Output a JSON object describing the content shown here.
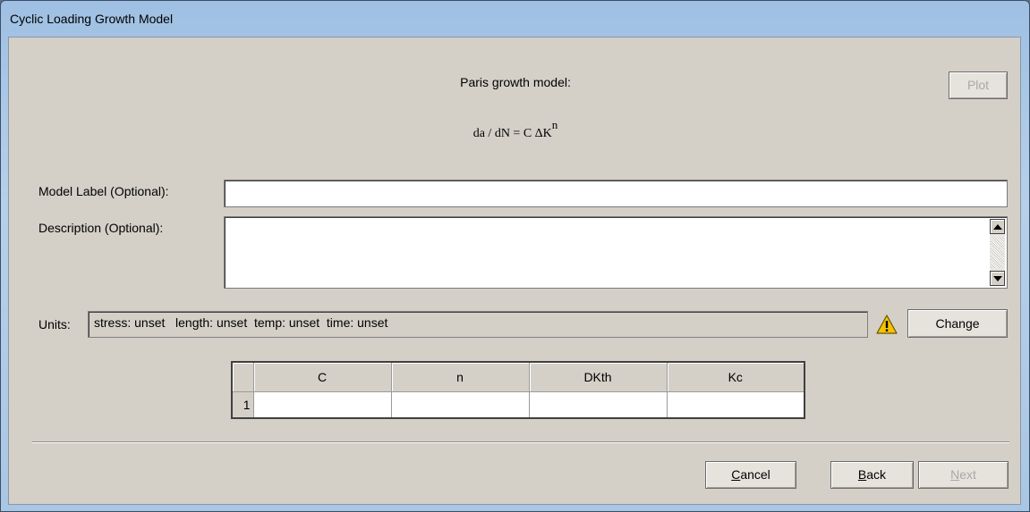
{
  "window": {
    "title": "Cyclic Loading Growth Model"
  },
  "header": {
    "heading": "Paris growth model:",
    "formula_base": "da / dN = C ΔK",
    "formula_exp": "n",
    "plot_label": "Plot"
  },
  "form": {
    "model_label": "Model Label (Optional):",
    "model_value": "",
    "description_label": "Description (Optional):",
    "description_value": "",
    "units_label": "Units:",
    "units_value": "stress: unset   length: unset  temp: unset  time: unset",
    "change_label": "Change",
    "warning_icon": "warning-icon",
    "warning_color": "#f5c400"
  },
  "table": {
    "columns": [
      "C",
      "n",
      "DKth",
      "Kc"
    ],
    "rows": [
      {
        "index": "1",
        "values": [
          "",
          "",
          "",
          ""
        ]
      }
    ]
  },
  "footer": {
    "cancel_first": "C",
    "cancel_rest": "ancel",
    "back_first": "B",
    "back_rest": "ack",
    "next_first": "N",
    "next_rest": "ext"
  }
}
